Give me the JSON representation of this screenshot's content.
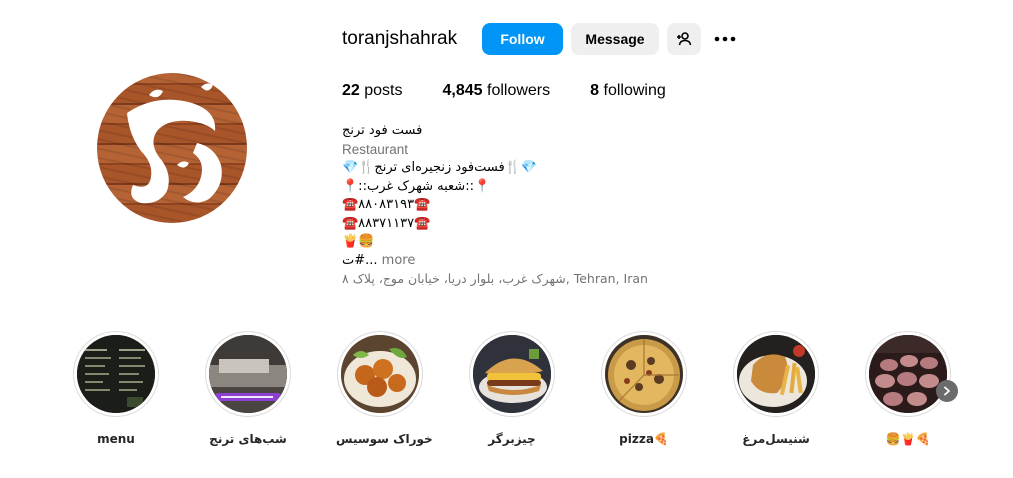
{
  "profile": {
    "username": "toranjshahrak",
    "follow_label": "Follow",
    "message_label": "Message",
    "avatar_logo_text": "ترنج",
    "stats": {
      "posts_count": "22",
      "posts_label": "posts",
      "followers_count": "4,845",
      "followers_label": "followers",
      "following_count": "8",
      "following_label": "following"
    }
  },
  "bio": {
    "name": "فست فود ترنج",
    "category": "Restaurant",
    "lines": [
      "💎🍴فست‌فود زنجیره‌ای ترنج🍴💎",
      "📍::شعبه شهرک غرب::📍",
      "☎️۸۸۰۸۳۱۹۳☎️",
      "☎️۸۸۳۷۱۱۳۷☎️",
      "🍟🍔"
    ],
    "truncated": "ت#... ",
    "more_label": "more",
    "address": "شهرک غرب، بلوار دریا، خیابان موج، پلاک ۸, Tehran, Iran"
  },
  "highlights": [
    {
      "label": "menu"
    },
    {
      "label": "شب‌های ترنج"
    },
    {
      "label": "خوراک سوسیس"
    },
    {
      "label": "چیزبرگر"
    },
    {
      "label": "pizza🍕"
    },
    {
      "label": "شنیسل‌مرغ"
    },
    {
      "label": "🍔🍟🍕"
    }
  ],
  "colors": {
    "accent": "#0095f6",
    "secondary_button": "#efefef",
    "muted_text": "#737373"
  },
  "icons": {
    "add_person": "add-person-icon",
    "more": "more-horizontal-icon",
    "next": "chevron-right-icon"
  }
}
